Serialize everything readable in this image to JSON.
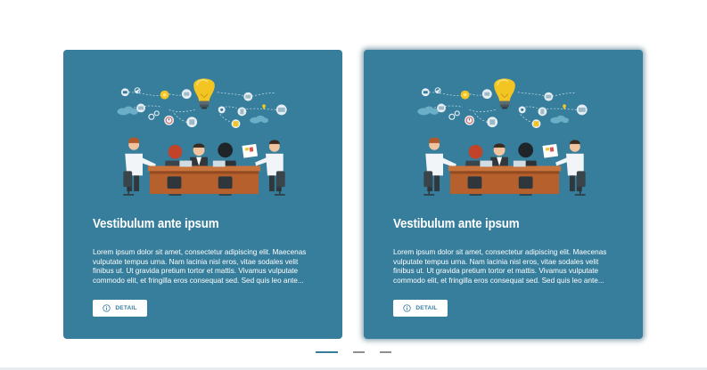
{
  "cards": [
    {
      "title": "Vestibulum ante ipsum",
      "text": "Lorem ipsum dolor sit amet, consectetur adipiscing elit. Maecenas vulputate tempus urna. Nam lacinia nisl eros, vitae sodales velit finibus ut. Ut gravida pretium tortor et mattis. Vivamus vulputate commodo elit, et fringilla eros consequat sed. Sed quis leo ante...",
      "button_label": "DETAIL",
      "illustration": "business-meeting-illustration",
      "active": false
    },
    {
      "title": "Vestibulum ante ipsum",
      "text": "Lorem ipsum dolor sit amet, consectetur adipiscing elit. Maecenas vulputate tempus urna. Nam lacinia nisl eros, vitae sodales velit finibus ut. Ut gravida pretium tortor et mattis. Vivamus vulputate commodo elit, et fringilla eros consequat sed. Sed quis leo ante...",
      "button_label": "DETAIL",
      "illustration": "business-meeting-illustration",
      "active": true
    }
  ],
  "pagination": {
    "count": 3,
    "active_index": 0
  },
  "colors": {
    "card_bg": "#367e9c",
    "button_bg": "#ffffff",
    "active_dot": "#367e9c",
    "inactive_dot": "#8f8f8f",
    "bulb": "#f3c522",
    "table": "#b5602d"
  },
  "icons": {
    "button": "info-icon"
  }
}
